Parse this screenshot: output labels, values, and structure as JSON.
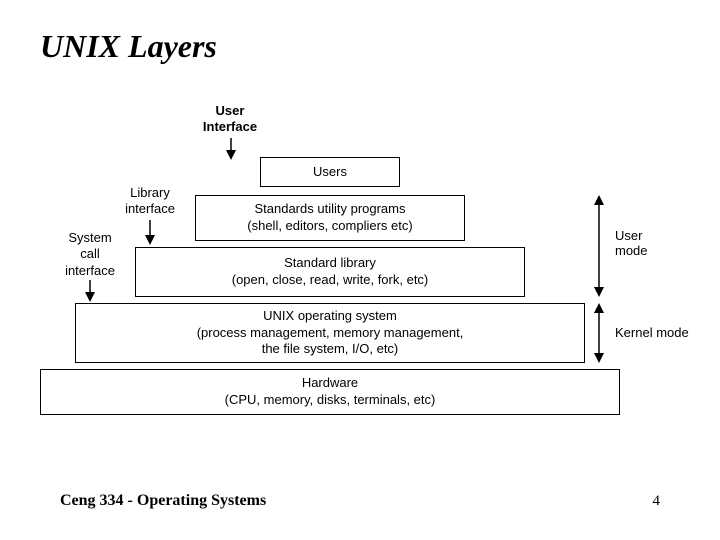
{
  "title": "UNIX Layers",
  "ui_label": {
    "line1": "User",
    "line2": "Interface"
  },
  "left_labels": {
    "library": {
      "line1": "Library",
      "line2": "interface"
    },
    "system": {
      "line1": "System",
      "line2": "call",
      "line3": "interface"
    }
  },
  "layers": {
    "users": "Users",
    "utility": {
      "line1": "Standards utility programs",
      "line2": "(shell, editors, compliers etc)"
    },
    "stdlib": {
      "line1": "Standard library",
      "line2": "(open, close, read, write, fork, etc)"
    },
    "os": {
      "line1": "UNIX operating system",
      "line2": "(process management, memory management,",
      "line3": "the file system, I/O, etc)"
    },
    "hw": {
      "line1": "Hardware",
      "line2": "(CPU, memory, disks, terminals, etc)"
    }
  },
  "right_labels": {
    "user_mode": {
      "line1": "User",
      "line2": "mode"
    },
    "kernel_mode": "Kernel mode"
  },
  "footer": {
    "course": "Ceng 334 - Operating Systems",
    "page": "4"
  }
}
